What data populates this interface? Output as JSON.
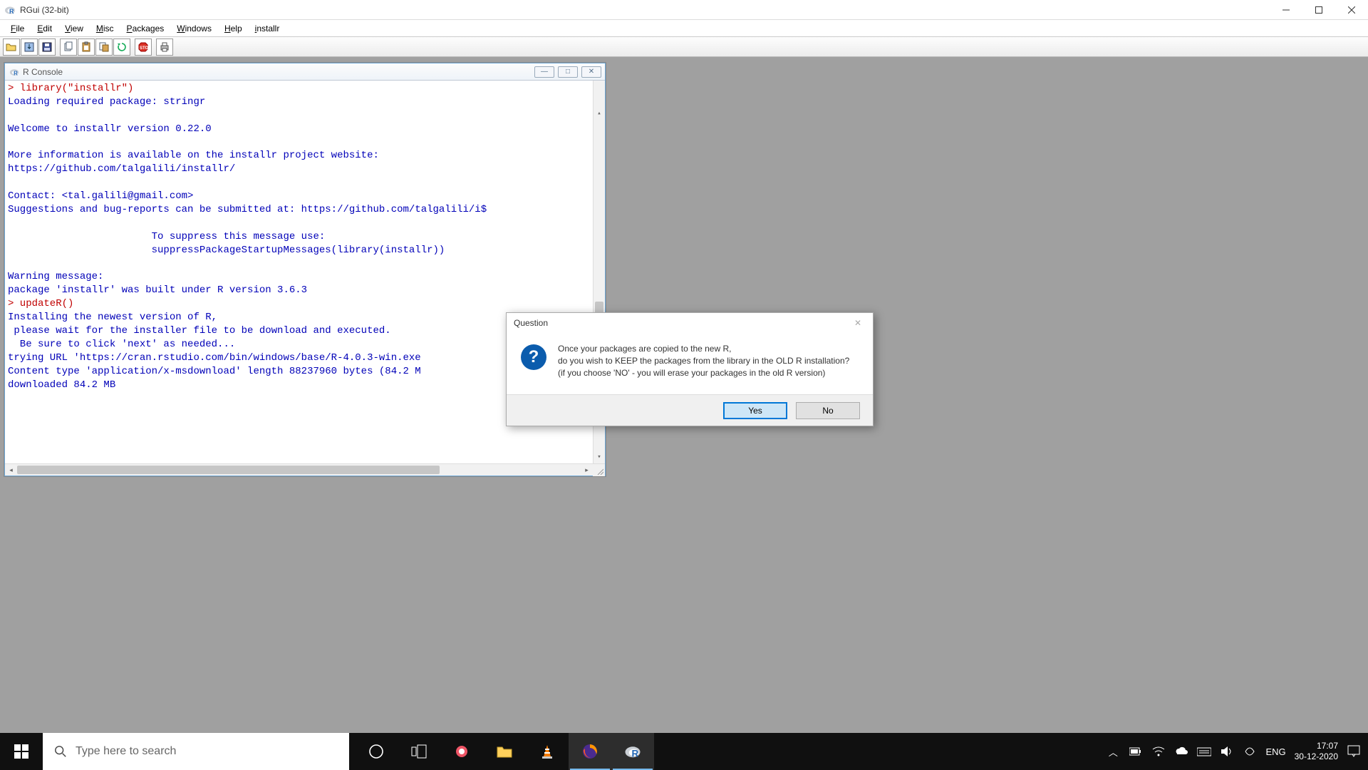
{
  "window": {
    "title": "RGui (32-bit)"
  },
  "menu": {
    "file": "File",
    "edit": "Edit",
    "view": "View",
    "misc": "Misc",
    "packages": "Packages",
    "windows": "Windows",
    "help": "Help",
    "installr": "installr"
  },
  "console": {
    "title": "R Console",
    "line1": "> library(\"installr\")",
    "line2": "Loading required package: stringr",
    "line3": "",
    "line4": "Welcome to installr version 0.22.0",
    "line5": "",
    "line6": "More information is available on the installr project website:",
    "line7": "https://github.com/talgalili/installr/",
    "line8": "",
    "line9": "Contact: <tal.galili@gmail.com>",
    "line10": "Suggestions and bug-reports can be submitted at: https://github.com/talgalili/i$",
    "line11": "",
    "line12": "                        To suppress this message use:",
    "line13": "                        suppressPackageStartupMessages(library(installr))",
    "line14": "",
    "line15": "Warning message:",
    "line16": "package 'installr' was built under R version 3.6.3 ",
    "line17": "> updateR()",
    "line18": "Installing the newest version of R,",
    "line19": " please wait for the installer file to be download and executed.",
    "line20": "  Be sure to click 'next' as needed...",
    "line21": "trying URL 'https://cran.rstudio.com/bin/windows/base/R-4.0.3-win.exe",
    "line22": "Content type 'application/x-msdownload' length 88237960 bytes (84.2 M",
    "line23": "downloaded 84.2 MB",
    "line24": ""
  },
  "dialog": {
    "title": "Question",
    "msg1": "Once your packages are copied to the new R,",
    "msg2": "do you wish to KEEP the packages from the library in the OLD R installation?",
    "msg3": "(if you choose 'NO' - you will erase your packages in the old R version)",
    "yes": "Yes",
    "no": "No"
  },
  "taskbar": {
    "search_placeholder": "Type here to search",
    "lang": "ENG",
    "time": "17:07",
    "date": "30-12-2020"
  }
}
